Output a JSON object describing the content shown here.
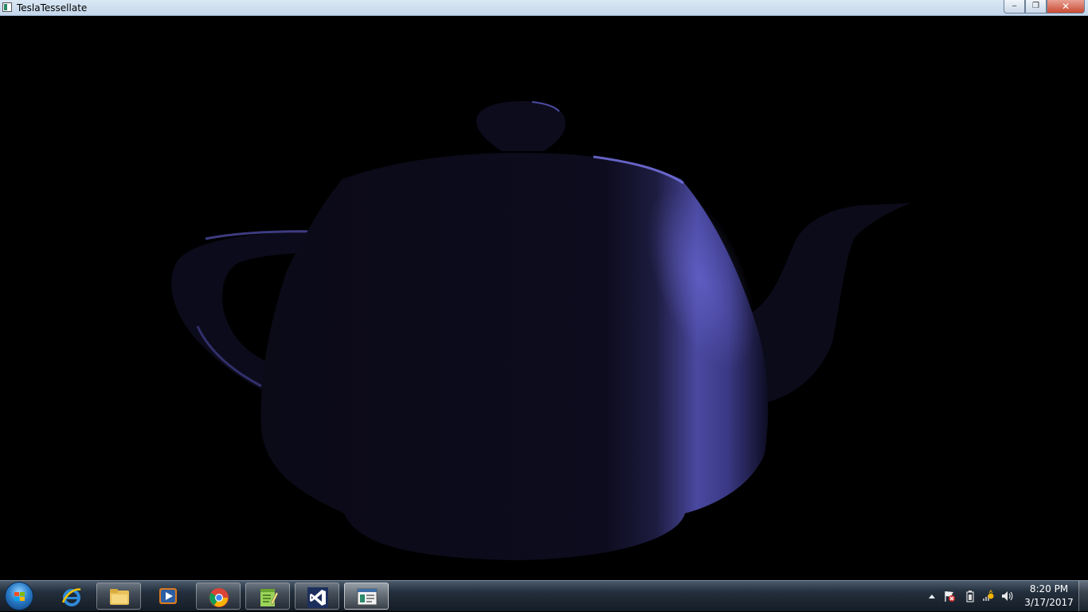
{
  "window": {
    "title": "TeslaTessellate",
    "controls": {
      "minimize": "‒",
      "maximize": "❐",
      "close": "✕"
    }
  },
  "scene": {
    "object": "teapot",
    "background": "#000000",
    "base_color": "#0d0c1d",
    "highlight_color": "#6c6ad8"
  },
  "taskbar": {
    "start_button": "windows-start-icon",
    "pinned": [
      {
        "name": "internet-explorer-icon"
      },
      {
        "name": "file-explorer-icon"
      },
      {
        "name": "media-player-icon"
      },
      {
        "name": "chrome-icon"
      },
      {
        "name": "notepad-plus-plus-icon"
      },
      {
        "name": "visual-studio-icon"
      },
      {
        "name": "app-window-icon"
      }
    ],
    "tray": {
      "icons": [
        "show-hidden-icons-icon",
        "action-center-flag-icon",
        "battery-icon",
        "network-icon",
        "volume-icon"
      ]
    },
    "clock": {
      "time": "8:20 PM",
      "date": "3/17/2017"
    }
  }
}
